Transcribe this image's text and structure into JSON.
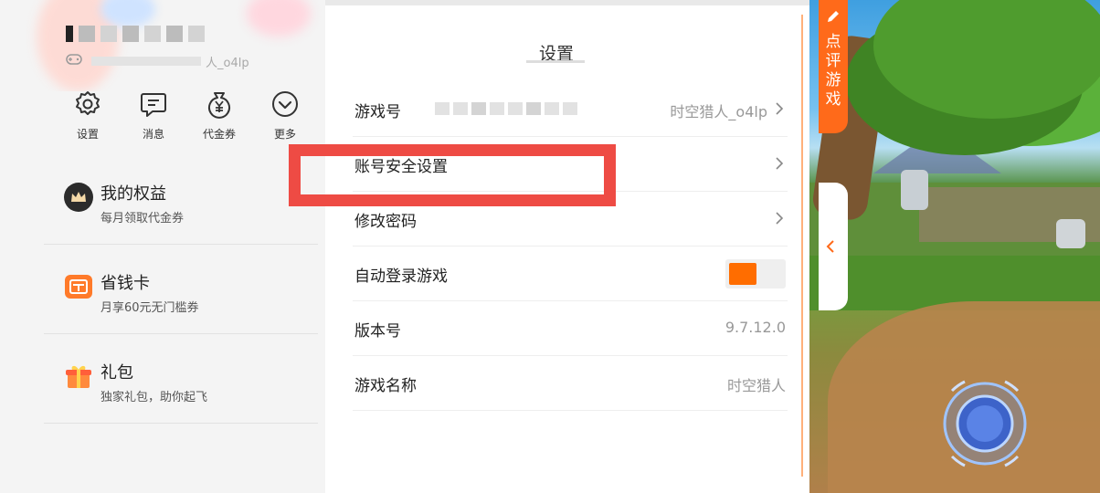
{
  "left": {
    "username_bracket": "[",
    "subtitle_suffix": "人_o4lp",
    "quick_actions": [
      {
        "label": "设置",
        "icon": "gear-icon"
      },
      {
        "label": "消息",
        "icon": "message-icon"
      },
      {
        "label": "代金券",
        "icon": "coupon-icon"
      },
      {
        "label": "更多",
        "icon": "chevron-down-circle-icon"
      }
    ],
    "benefits": [
      {
        "title": "我的权益",
        "desc": "每月领取代金券",
        "icon": "crown-icon"
      },
      {
        "title": "省钱卡",
        "desc": "月享60元无门槛券",
        "icon": "savings-card-icon"
      },
      {
        "title": "礼包",
        "desc": "独家礼包，助你起飞",
        "icon": "gift-icon"
      }
    ]
  },
  "settings": {
    "title": "设置",
    "rows": [
      {
        "label": "游戏号",
        "value": "时空猎人_o4lp",
        "chevron": true
      },
      {
        "label": "账号安全设置",
        "value": "",
        "chevron": true
      },
      {
        "label": "修改密码",
        "value": "",
        "chevron": true
      },
      {
        "label": "自动登录游戏",
        "toggle": true,
        "toggle_on": true
      },
      {
        "label": "版本号",
        "value": "9.7.12.0",
        "chevron": false
      },
      {
        "label": "游戏名称",
        "value": "时空猎人",
        "chevron": false
      }
    ]
  },
  "game": {
    "review_tab": "点评游戏"
  },
  "colors": {
    "accent": "#ff6a1a",
    "highlight": "#ee4b44",
    "toggle_on": "#ff6d00"
  }
}
